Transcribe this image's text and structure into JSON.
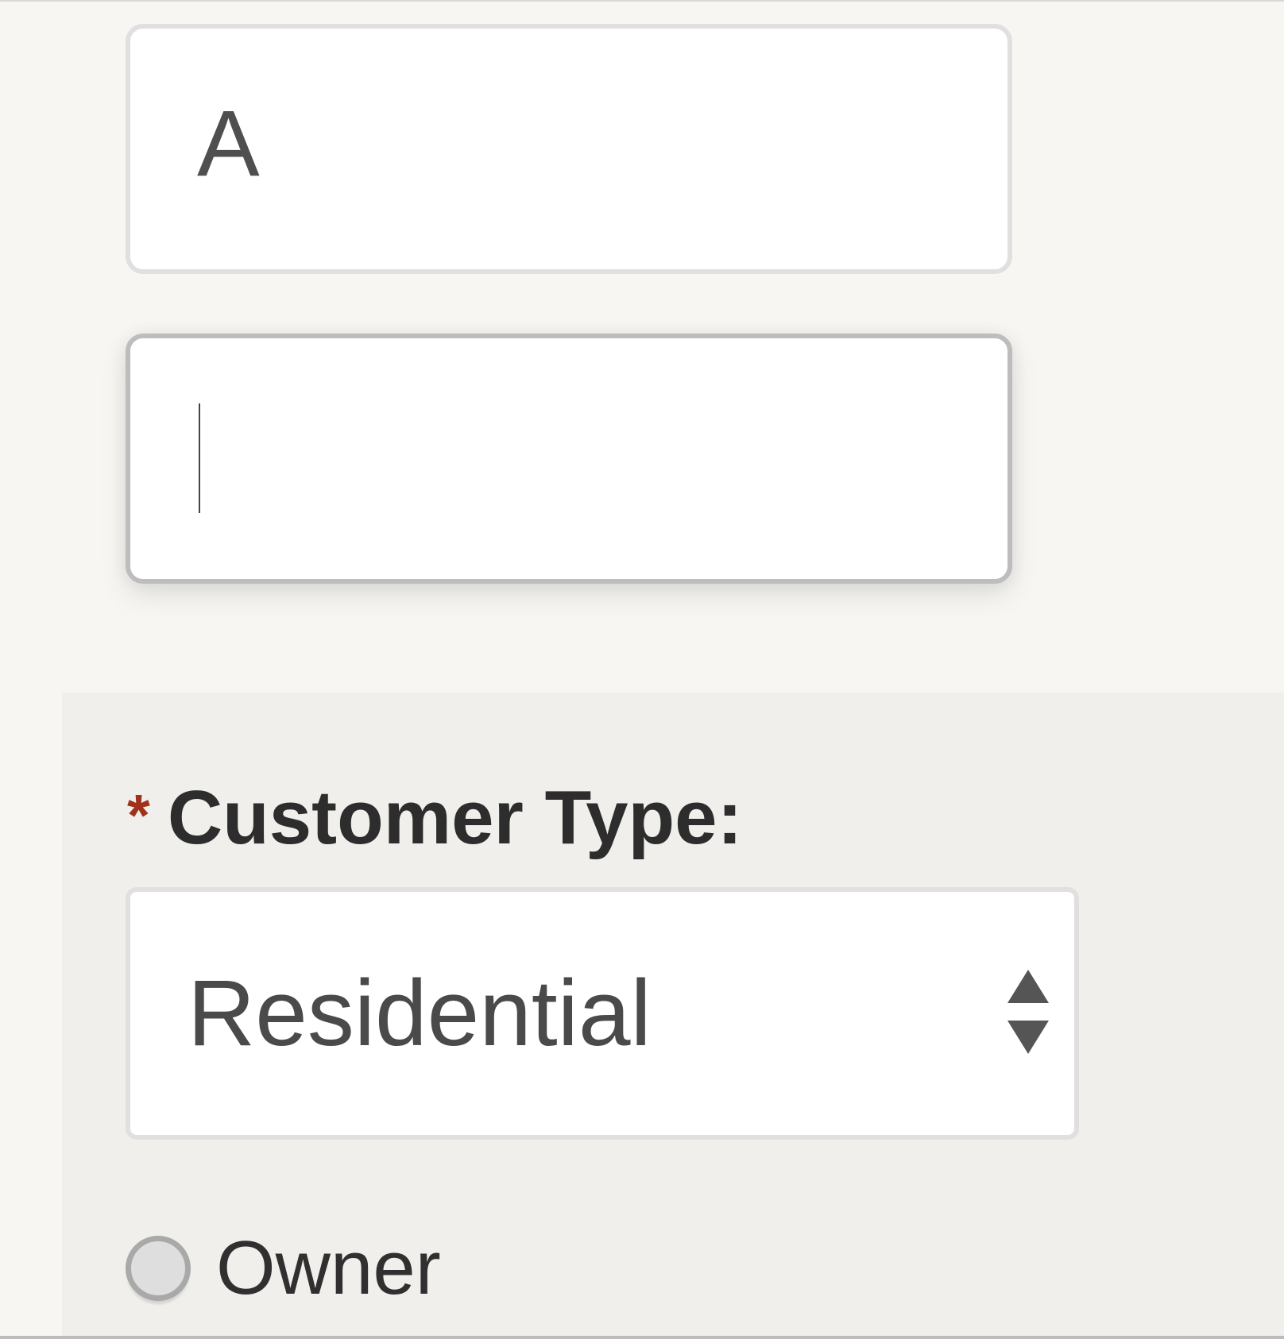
{
  "fields": {
    "first_value": "A",
    "second_value": ""
  },
  "customer_type": {
    "required_marker": "*",
    "label": "Customer Type:",
    "selected": "Residential",
    "stepper_icon": "up-down-arrows-icon"
  },
  "radio_options": [
    {
      "label": "Owner",
      "checked": false
    }
  ],
  "colors": {
    "required": "#a0311c",
    "label_text": "#2d2d2d",
    "value_text": "#4a4a4a",
    "section_bg": "#f1efeb",
    "page_bg": "#f7f6f3"
  }
}
